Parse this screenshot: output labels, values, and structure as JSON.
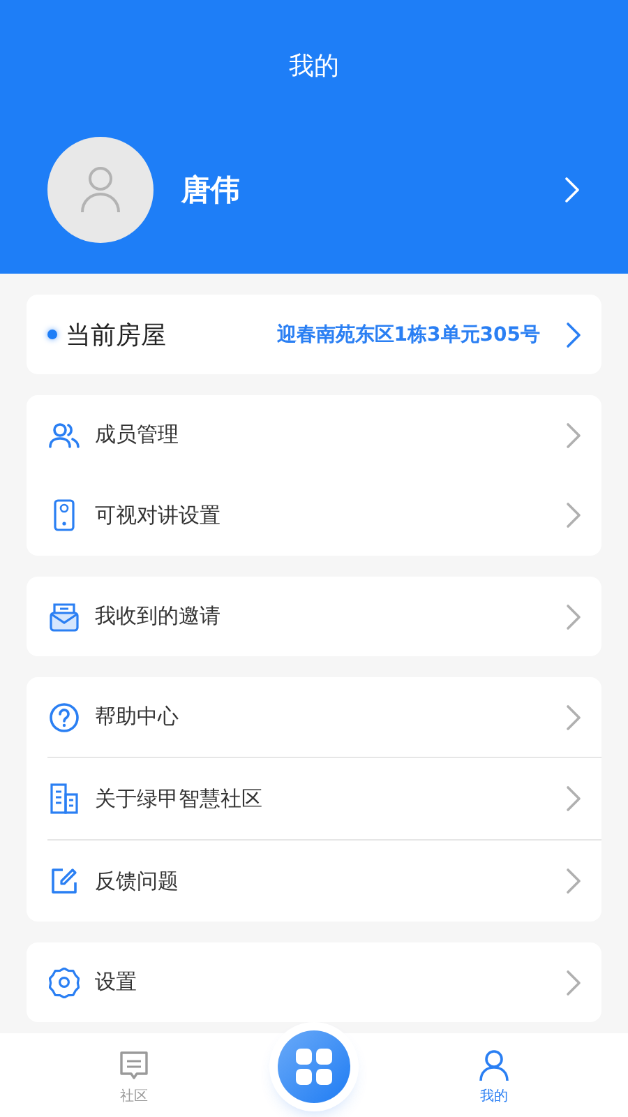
{
  "header": {
    "title": "我的"
  },
  "profile": {
    "name": "唐伟"
  },
  "current_house": {
    "label": "当前房屋",
    "address": "迎春南苑东区1栋3单元305号"
  },
  "groups": [
    {
      "items": [
        {
          "label": "成员管理"
        },
        {
          "label": "可视对讲设置"
        }
      ]
    },
    {
      "items": [
        {
          "label": "我收到的邀请"
        }
      ]
    },
    {
      "items": [
        {
          "label": "帮助中心"
        },
        {
          "label": "关于绿甲智慧社区"
        },
        {
          "label": "反馈问题"
        }
      ]
    },
    {
      "items": [
        {
          "label": "设置"
        }
      ]
    }
  ],
  "tab_bar": {
    "tabs": [
      {
        "label": "社区",
        "selected": false
      },
      {
        "label": "我的",
        "selected": true
      }
    ]
  }
}
